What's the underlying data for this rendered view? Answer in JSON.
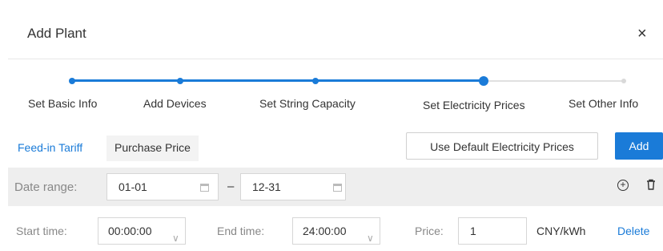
{
  "dialog": {
    "title": "Add Plant",
    "close_symbol": "×"
  },
  "steps": [
    {
      "label": "Set Basic Info",
      "state": "done"
    },
    {
      "label": "Add Devices",
      "state": "done"
    },
    {
      "label": "Set String Capacity",
      "state": "done"
    },
    {
      "label": "Set Electricity Prices",
      "state": "current"
    },
    {
      "label": "Set Other Info",
      "state": "pending"
    }
  ],
  "tabs": {
    "feed_in": "Feed-in Tariff",
    "purchase": "Purchase Price"
  },
  "buttons": {
    "use_default": "Use Default Electricity Prices",
    "add": "Add"
  },
  "date_range": {
    "label": "Date range:",
    "start": "01-01",
    "separator": "–",
    "end": "12-31"
  },
  "period": {
    "start_label": "Start time:",
    "start_value": "00:00:00",
    "end_label": "End time:",
    "end_value": "24:00:00",
    "price_label": "Price:",
    "price_value": "1",
    "unit": "CNY/kWh",
    "delete": "Delete"
  },
  "colors": {
    "accent": "#1a7bd8",
    "row_bg": "#eeeeee"
  }
}
